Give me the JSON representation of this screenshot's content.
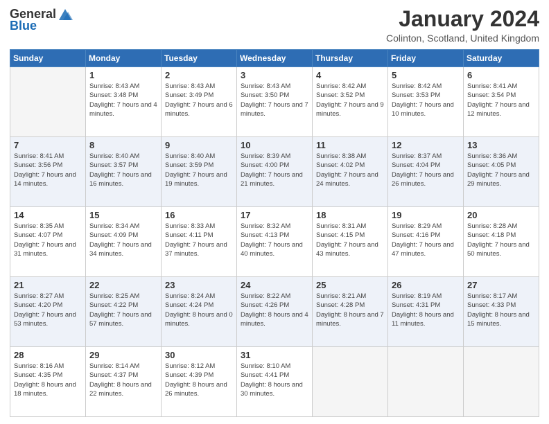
{
  "header": {
    "logo_general": "General",
    "logo_blue": "Blue",
    "title": "January 2024",
    "location": "Colinton, Scotland, United Kingdom"
  },
  "weekdays": [
    "Sunday",
    "Monday",
    "Tuesday",
    "Wednesday",
    "Thursday",
    "Friday",
    "Saturday"
  ],
  "weeks": [
    [
      {
        "day": "",
        "sunrise": "",
        "sunset": "",
        "daylight": ""
      },
      {
        "day": "1",
        "sunrise": "Sunrise: 8:43 AM",
        "sunset": "Sunset: 3:48 PM",
        "daylight": "Daylight: 7 hours and 4 minutes."
      },
      {
        "day": "2",
        "sunrise": "Sunrise: 8:43 AM",
        "sunset": "Sunset: 3:49 PM",
        "daylight": "Daylight: 7 hours and 6 minutes."
      },
      {
        "day": "3",
        "sunrise": "Sunrise: 8:43 AM",
        "sunset": "Sunset: 3:50 PM",
        "daylight": "Daylight: 7 hours and 7 minutes."
      },
      {
        "day": "4",
        "sunrise": "Sunrise: 8:42 AM",
        "sunset": "Sunset: 3:52 PM",
        "daylight": "Daylight: 7 hours and 9 minutes."
      },
      {
        "day": "5",
        "sunrise": "Sunrise: 8:42 AM",
        "sunset": "Sunset: 3:53 PM",
        "daylight": "Daylight: 7 hours and 10 minutes."
      },
      {
        "day": "6",
        "sunrise": "Sunrise: 8:41 AM",
        "sunset": "Sunset: 3:54 PM",
        "daylight": "Daylight: 7 hours and 12 minutes."
      }
    ],
    [
      {
        "day": "7",
        "sunrise": "Sunrise: 8:41 AM",
        "sunset": "Sunset: 3:56 PM",
        "daylight": "Daylight: 7 hours and 14 minutes."
      },
      {
        "day": "8",
        "sunrise": "Sunrise: 8:40 AM",
        "sunset": "Sunset: 3:57 PM",
        "daylight": "Daylight: 7 hours and 16 minutes."
      },
      {
        "day": "9",
        "sunrise": "Sunrise: 8:40 AM",
        "sunset": "Sunset: 3:59 PM",
        "daylight": "Daylight: 7 hours and 19 minutes."
      },
      {
        "day": "10",
        "sunrise": "Sunrise: 8:39 AM",
        "sunset": "Sunset: 4:00 PM",
        "daylight": "Daylight: 7 hours and 21 minutes."
      },
      {
        "day": "11",
        "sunrise": "Sunrise: 8:38 AM",
        "sunset": "Sunset: 4:02 PM",
        "daylight": "Daylight: 7 hours and 24 minutes."
      },
      {
        "day": "12",
        "sunrise": "Sunrise: 8:37 AM",
        "sunset": "Sunset: 4:04 PM",
        "daylight": "Daylight: 7 hours and 26 minutes."
      },
      {
        "day": "13",
        "sunrise": "Sunrise: 8:36 AM",
        "sunset": "Sunset: 4:05 PM",
        "daylight": "Daylight: 7 hours and 29 minutes."
      }
    ],
    [
      {
        "day": "14",
        "sunrise": "Sunrise: 8:35 AM",
        "sunset": "Sunset: 4:07 PM",
        "daylight": "Daylight: 7 hours and 31 minutes."
      },
      {
        "day": "15",
        "sunrise": "Sunrise: 8:34 AM",
        "sunset": "Sunset: 4:09 PM",
        "daylight": "Daylight: 7 hours and 34 minutes."
      },
      {
        "day": "16",
        "sunrise": "Sunrise: 8:33 AM",
        "sunset": "Sunset: 4:11 PM",
        "daylight": "Daylight: 7 hours and 37 minutes."
      },
      {
        "day": "17",
        "sunrise": "Sunrise: 8:32 AM",
        "sunset": "Sunset: 4:13 PM",
        "daylight": "Daylight: 7 hours and 40 minutes."
      },
      {
        "day": "18",
        "sunrise": "Sunrise: 8:31 AM",
        "sunset": "Sunset: 4:15 PM",
        "daylight": "Daylight: 7 hours and 43 minutes."
      },
      {
        "day": "19",
        "sunrise": "Sunrise: 8:29 AM",
        "sunset": "Sunset: 4:16 PM",
        "daylight": "Daylight: 7 hours and 47 minutes."
      },
      {
        "day": "20",
        "sunrise": "Sunrise: 8:28 AM",
        "sunset": "Sunset: 4:18 PM",
        "daylight": "Daylight: 7 hours and 50 minutes."
      }
    ],
    [
      {
        "day": "21",
        "sunrise": "Sunrise: 8:27 AM",
        "sunset": "Sunset: 4:20 PM",
        "daylight": "Daylight: 7 hours and 53 minutes."
      },
      {
        "day": "22",
        "sunrise": "Sunrise: 8:25 AM",
        "sunset": "Sunset: 4:22 PM",
        "daylight": "Daylight: 7 hours and 57 minutes."
      },
      {
        "day": "23",
        "sunrise": "Sunrise: 8:24 AM",
        "sunset": "Sunset: 4:24 PM",
        "daylight": "Daylight: 8 hours and 0 minutes."
      },
      {
        "day": "24",
        "sunrise": "Sunrise: 8:22 AM",
        "sunset": "Sunset: 4:26 PM",
        "daylight": "Daylight: 8 hours and 4 minutes."
      },
      {
        "day": "25",
        "sunrise": "Sunrise: 8:21 AM",
        "sunset": "Sunset: 4:28 PM",
        "daylight": "Daylight: 8 hours and 7 minutes."
      },
      {
        "day": "26",
        "sunrise": "Sunrise: 8:19 AM",
        "sunset": "Sunset: 4:31 PM",
        "daylight": "Daylight: 8 hours and 11 minutes."
      },
      {
        "day": "27",
        "sunrise": "Sunrise: 8:17 AM",
        "sunset": "Sunset: 4:33 PM",
        "daylight": "Daylight: 8 hours and 15 minutes."
      }
    ],
    [
      {
        "day": "28",
        "sunrise": "Sunrise: 8:16 AM",
        "sunset": "Sunset: 4:35 PM",
        "daylight": "Daylight: 8 hours and 18 minutes."
      },
      {
        "day": "29",
        "sunrise": "Sunrise: 8:14 AM",
        "sunset": "Sunset: 4:37 PM",
        "daylight": "Daylight: 8 hours and 22 minutes."
      },
      {
        "day": "30",
        "sunrise": "Sunrise: 8:12 AM",
        "sunset": "Sunset: 4:39 PM",
        "daylight": "Daylight: 8 hours and 26 minutes."
      },
      {
        "day": "31",
        "sunrise": "Sunrise: 8:10 AM",
        "sunset": "Sunset: 4:41 PM",
        "daylight": "Daylight: 8 hours and 30 minutes."
      },
      {
        "day": "",
        "sunrise": "",
        "sunset": "",
        "daylight": ""
      },
      {
        "day": "",
        "sunrise": "",
        "sunset": "",
        "daylight": ""
      },
      {
        "day": "",
        "sunrise": "",
        "sunset": "",
        "daylight": ""
      }
    ]
  ]
}
